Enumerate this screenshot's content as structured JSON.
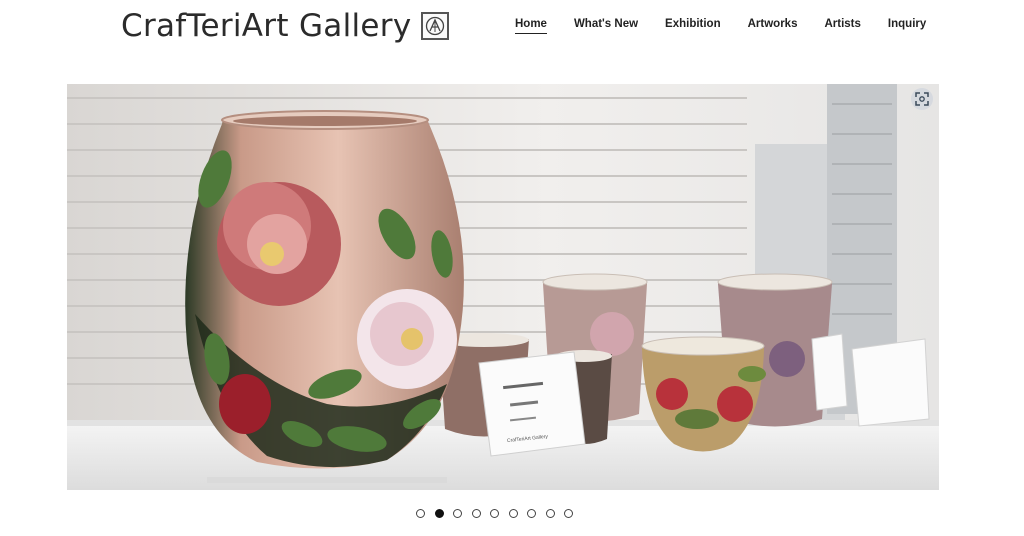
{
  "site": {
    "title": "CrafTeriArt Gallery",
    "logo_icon": "monogram-seal-icon"
  },
  "nav": {
    "items": [
      {
        "label": "Home",
        "active": true
      },
      {
        "label": "What's New",
        "active": false
      },
      {
        "label": "Exhibition",
        "active": false
      },
      {
        "label": "Artworks",
        "active": false
      },
      {
        "label": "Artists",
        "active": false
      },
      {
        "label": "Inquiry",
        "active": false
      }
    ]
  },
  "hero": {
    "zoom_icon": "expand-icon",
    "card": {
      "maker": "CrafTeriArt Gallery"
    }
  },
  "slider": {
    "total": 9,
    "current": 2
  },
  "colors": {
    "text": "#222222",
    "dot_active": "#111111",
    "background": "#ffffff"
  }
}
